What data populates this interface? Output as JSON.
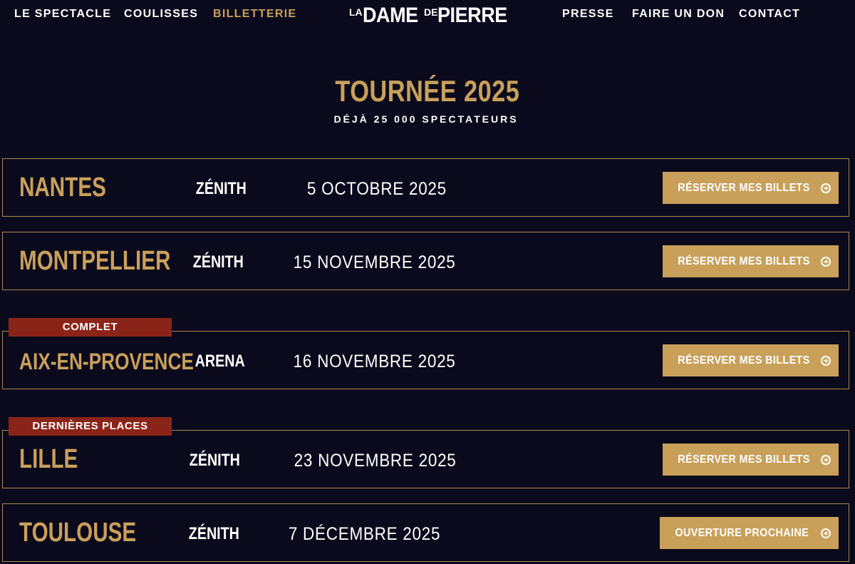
{
  "nav": {
    "left": [
      "LE SPECTACLE",
      "COULISSES",
      "BILLETTERIE"
    ],
    "right": [
      "PRESSE",
      "FAIRE UN DON",
      "CONTACT"
    ],
    "active": "BILLETTERIE",
    "logo": {
      "la": "LA",
      "dame": "DAME",
      "de": "DE",
      "pierre": "PIERRE"
    }
  },
  "header": {
    "title": "TOURNÉE 2025",
    "subtitle": "DÉJÀ 25 000 SPECTATEURS"
  },
  "events": [
    {
      "city": "NANTES",
      "venue": "ZÉNITH",
      "date": "5 OCTOBRE 2025",
      "cta": "RÉSERVER MES BILLETS",
      "badge": ""
    },
    {
      "city": "MONTPELLIER",
      "venue": "ZÉNITH",
      "date": "15 NOVEMBRE 2025",
      "cta": "RÉSERVER MES BILLETS",
      "badge": ""
    },
    {
      "city": "AIX-EN-PROVENCE",
      "venue": "ARENA",
      "date": "16 NOVEMBRE 2025",
      "cta": "RÉSERVER MES BILLETS",
      "badge": "COMPLET"
    },
    {
      "city": "LILLE",
      "venue": "ZÉNITH",
      "date": "23 NOVEMBRE 2025",
      "cta": "RÉSERVER MES BILLETS",
      "badge": "DERNIÈRES PLACES"
    },
    {
      "city": "TOULOUSE",
      "venue": "ZÉNITH",
      "date": "7 DÉCEMBRE 2025",
      "cta": "OUVERTURE PROCHAINE",
      "badge": ""
    }
  ],
  "colors": {
    "background": "#0b0a1d",
    "gold": "#c9a05a",
    "badge_red": "#8b2418",
    "text": "#ffffff"
  },
  "icons": {
    "cta_icon": "arrow-circle-right-icon"
  }
}
